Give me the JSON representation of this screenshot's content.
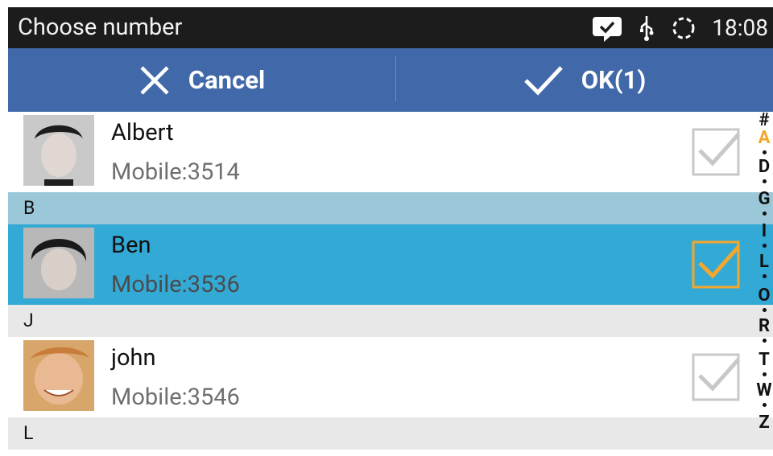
{
  "status_bar": {
    "title": "Choose number",
    "time": "18:08",
    "icons": [
      "chat-check-icon",
      "usb-icon",
      "sync-icon"
    ]
  },
  "action_bar": {
    "cancel_label": "Cancel",
    "ok_label": "OK(1)"
  },
  "contacts": [
    {
      "name": "Albert",
      "number": "Mobile:3514",
      "checked": false
    },
    {
      "name": "Ben",
      "number": "Mobile:3536",
      "checked": true
    },
    {
      "name": "john",
      "number": "Mobile:3546",
      "checked": false
    }
  ],
  "section_headers": [
    "B",
    "J",
    "L"
  ],
  "index": [
    "#",
    "A",
    "D",
    "G",
    "I",
    "L",
    "O",
    "R",
    "T",
    "W",
    "Z"
  ],
  "index_active": "A",
  "colors": {
    "action_bar": "#4168a8",
    "selected_row": "#33a9d6",
    "header_b": "#9bc8d8",
    "header_default": "#e8e8e8",
    "checked": "#f4a72a"
  }
}
